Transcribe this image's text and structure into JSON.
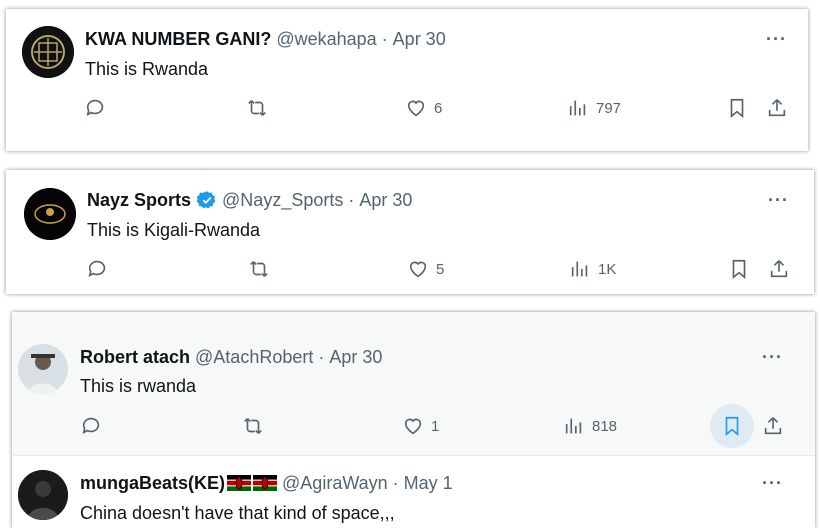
{
  "tweets": [
    {
      "name": "KWA NUMBER GANI?",
      "handle": "@wekahapa",
      "date": "Apr 30",
      "text": "This is Rwanda",
      "likes": "6",
      "views": "797"
    },
    {
      "name": "Nayz Sports",
      "handle": "@Nayz_Sports",
      "date": "Apr 30",
      "text": "This is Kigali-Rwanda",
      "likes": "5",
      "views": "1K",
      "verified": true
    },
    {
      "name": "Robert atach",
      "handle": "@AtachRobert",
      "date": "Apr 30",
      "text": "This is rwanda",
      "likes": "1",
      "views": "818"
    },
    {
      "name": "mungaBeats(KE)",
      "handle": "@AgiraWayn",
      "date": "May 1",
      "text": "China doesn't have that kind of space,,,"
    }
  ],
  "separator": "·",
  "more_label": "···",
  "colors": {
    "verified": "#1d9bf0",
    "secondary": "#536471",
    "hover_bg": "#dfeaf3"
  }
}
